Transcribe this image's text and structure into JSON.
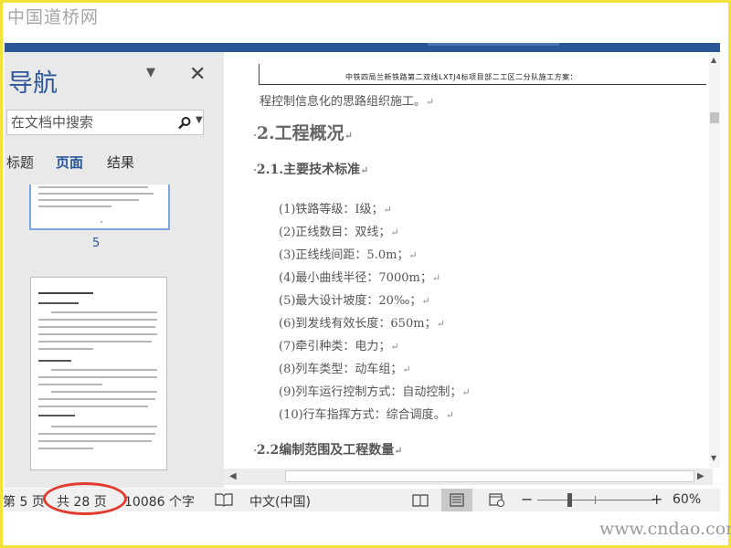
{
  "watermark": {
    "top": "中国道桥网",
    "bottom": "www.cndao.com"
  },
  "nav": {
    "title": "导航",
    "dropdown_glyph": "▼",
    "close_glyph": "✕",
    "search_placeholder": "在文档中搜索",
    "tabs": [
      {
        "label": "标题",
        "active": false
      },
      {
        "label": "页面",
        "active": true
      },
      {
        "label": "结果",
        "active": false
      }
    ],
    "thumbnails": [
      {
        "page_number": "5"
      }
    ]
  },
  "document": {
    "header": "中铁四局兰新铁路第二双线LXTJ4标项目部二工区二分队施工方案：",
    "lines": [
      {
        "text": "程控制信息化的思路组织施工。",
        "kind": "body"
      },
      {
        "text": "2.工程概况",
        "kind": "h1"
      },
      {
        "text": "2.1.主要技术标准",
        "kind": "h2"
      },
      {
        "text": "(1)铁路等级：Ⅰ级；",
        "kind": "item"
      },
      {
        "text": "(2)正线数目：双线；",
        "kind": "item"
      },
      {
        "text": "(3)正线线间距：5.0m；",
        "kind": "item"
      },
      {
        "text": "(4)最小曲线半径：7000m；",
        "kind": "item"
      },
      {
        "text": "(5)最大设计坡度：20‰；",
        "kind": "item"
      },
      {
        "text": "(6)到发线有效长度：650m；",
        "kind": "item"
      },
      {
        "text": "(7)牵引种类：电力；",
        "kind": "item"
      },
      {
        "text": "(8)列车类型：动车组；",
        "kind": "item"
      },
      {
        "text": "(9)列车运行控制方式：自动控制；",
        "kind": "item"
      },
      {
        "text": "(10)行车指挥方式：综合调度。",
        "kind": "item"
      },
      {
        "text": "2.2编制范围及工程数量",
        "kind": "h2"
      }
    ],
    "paragraph_mark": "↵",
    "bullet": "·"
  },
  "status_bar": {
    "page": "第 5 页",
    "total": "共 28 页",
    "words": "10086 个字",
    "language": "中文(中国)",
    "zoom_minus": "−",
    "zoom_plus": "+",
    "zoom": "60%",
    "zoom_level_percent": 60
  },
  "colors": {
    "accent": "#2b579a",
    "highlight_ellipse": "#e23a2c",
    "frame": "#f2e33a"
  }
}
